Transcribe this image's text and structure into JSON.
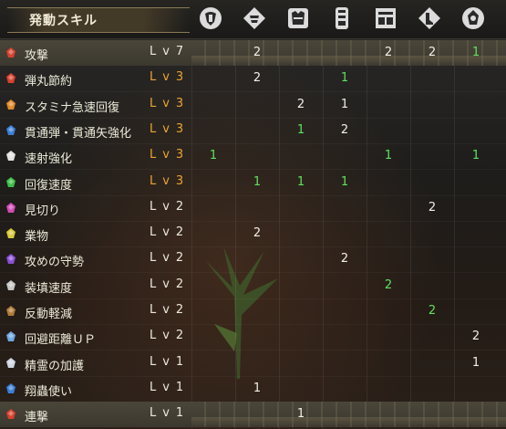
{
  "panel": {
    "title": "発動スキル"
  },
  "columns": [
    {
      "icon": "weapon-slot-icon"
    },
    {
      "icon": "helm-icon"
    },
    {
      "icon": "chest-armor-icon"
    },
    {
      "icon": "arm-armor-icon"
    },
    {
      "icon": "waist-armor-icon"
    },
    {
      "icon": "leg-armor-icon"
    },
    {
      "icon": "charm-icon"
    }
  ],
  "colors": {
    "level_max": "#e9a433",
    "level_normal": "#ece8dd",
    "value_white": "#f2efe6",
    "value_green": "#5fe15f"
  },
  "skills": [
    {
      "name": "攻撃",
      "level": "Lv7",
      "maxed": false,
      "highlight": true,
      "icon_color": "#d9412f",
      "values": [
        "",
        "2",
        "",
        "",
        "2",
        "2",
        "1"
      ],
      "value_colors": [
        "",
        "white",
        "",
        "",
        "white",
        "white",
        "green"
      ]
    },
    {
      "name": "弾丸節約",
      "level": "Lv3",
      "maxed": true,
      "highlight": false,
      "icon_color": "#d9412f",
      "values": [
        "",
        "2",
        "",
        "1",
        "",
        "",
        ""
      ],
      "value_colors": [
        "",
        "white",
        "",
        "green",
        "",
        "",
        ""
      ]
    },
    {
      "name": "スタミナ急速回復",
      "level": "Lv3",
      "maxed": true,
      "highlight": false,
      "icon_color": "#e08a2a",
      "values": [
        "",
        "",
        "2",
        "1",
        "",
        "",
        ""
      ],
      "value_colors": [
        "",
        "",
        "white",
        "white",
        "",
        "",
        ""
      ]
    },
    {
      "name": "貫通弾・貫通矢強化",
      "level": "Lv3",
      "maxed": true,
      "highlight": false,
      "icon_color": "#3b7fd6",
      "values": [
        "",
        "",
        "1",
        "2",
        "",
        "",
        ""
      ],
      "value_colors": [
        "",
        "",
        "green",
        "white",
        "",
        "",
        ""
      ]
    },
    {
      "name": "速射強化",
      "level": "Lv3",
      "maxed": true,
      "highlight": false,
      "icon_color": "#e2e2e2",
      "values": [
        "1",
        "",
        "",
        "",
        "1",
        "",
        "1"
      ],
      "value_colors": [
        "green",
        "",
        "",
        "",
        "green",
        "",
        "green"
      ]
    },
    {
      "name": "回復速度",
      "level": "Lv3",
      "maxed": true,
      "highlight": false,
      "icon_color": "#3fbf4b",
      "values": [
        "",
        "1",
        "1",
        "1",
        "",
        "",
        ""
      ],
      "value_colors": [
        "",
        "green",
        "green",
        "green",
        "",
        "",
        ""
      ]
    },
    {
      "name": "見切り",
      "level": "Lv2",
      "maxed": false,
      "highlight": false,
      "icon_color": "#d24ab5",
      "values": [
        "",
        "",
        "",
        "",
        "",
        "2",
        ""
      ],
      "value_colors": [
        "",
        "",
        "",
        "",
        "",
        "white",
        ""
      ]
    },
    {
      "name": "業物",
      "level": "Lv2",
      "maxed": false,
      "highlight": false,
      "icon_color": "#d8c93a",
      "values": [
        "",
        "2",
        "",
        "",
        "",
        "",
        ""
      ],
      "value_colors": [
        "",
        "white",
        "",
        "",
        "",
        "",
        ""
      ]
    },
    {
      "name": "攻めの守勢",
      "level": "Lv2",
      "maxed": false,
      "highlight": false,
      "icon_color": "#8a4fd6",
      "values": [
        "",
        "",
        "",
        "2",
        "",
        "",
        ""
      ],
      "value_colors": [
        "",
        "",
        "",
        "white",
        "",
        "",
        ""
      ]
    },
    {
      "name": "装填速度",
      "level": "Lv2",
      "maxed": false,
      "highlight": false,
      "icon_color": "#c6c6c6",
      "values": [
        "",
        "",
        "",
        "",
        "2",
        "",
        ""
      ],
      "value_colors": [
        "",
        "",
        "",
        "",
        "green",
        "",
        ""
      ]
    },
    {
      "name": "反動軽減",
      "level": "Lv2",
      "maxed": false,
      "highlight": false,
      "icon_color": "#b07a3a",
      "values": [
        "",
        "",
        "",
        "",
        "",
        "2",
        ""
      ],
      "value_colors": [
        "",
        "",
        "",
        "",
        "",
        "green",
        ""
      ]
    },
    {
      "name": "回避距離ＵＰ",
      "level": "Lv2",
      "maxed": false,
      "highlight": false,
      "icon_color": "#6fa6e0",
      "values": [
        "",
        "",
        "",
        "",
        "",
        "",
        "2"
      ],
      "value_colors": [
        "",
        "",
        "",
        "",
        "",
        "",
        "white"
      ]
    },
    {
      "name": "精霊の加護",
      "level": "Lv1",
      "maxed": false,
      "highlight": false,
      "icon_color": "#cfd6e3",
      "values": [
        "",
        "",
        "",
        "",
        "",
        "",
        "1"
      ],
      "value_colors": [
        "",
        "",
        "",
        "",
        "",
        "",
        "white"
      ]
    },
    {
      "name": "翔蟲使い",
      "level": "Lv1",
      "maxed": false,
      "highlight": false,
      "icon_color": "#3b7fd6",
      "values": [
        "",
        "1",
        "",
        "",
        "",
        "",
        ""
      ],
      "value_colors": [
        "",
        "white",
        "",
        "",
        "",
        "",
        ""
      ]
    },
    {
      "name": "連撃",
      "level": "Lv1",
      "maxed": false,
      "highlight": true,
      "icon_color": "#d9412f",
      "values": [
        "",
        "",
        "1",
        "",
        "",
        "",
        ""
      ],
      "value_colors": [
        "",
        "",
        "white",
        "",
        "",
        "",
        ""
      ]
    }
  ]
}
